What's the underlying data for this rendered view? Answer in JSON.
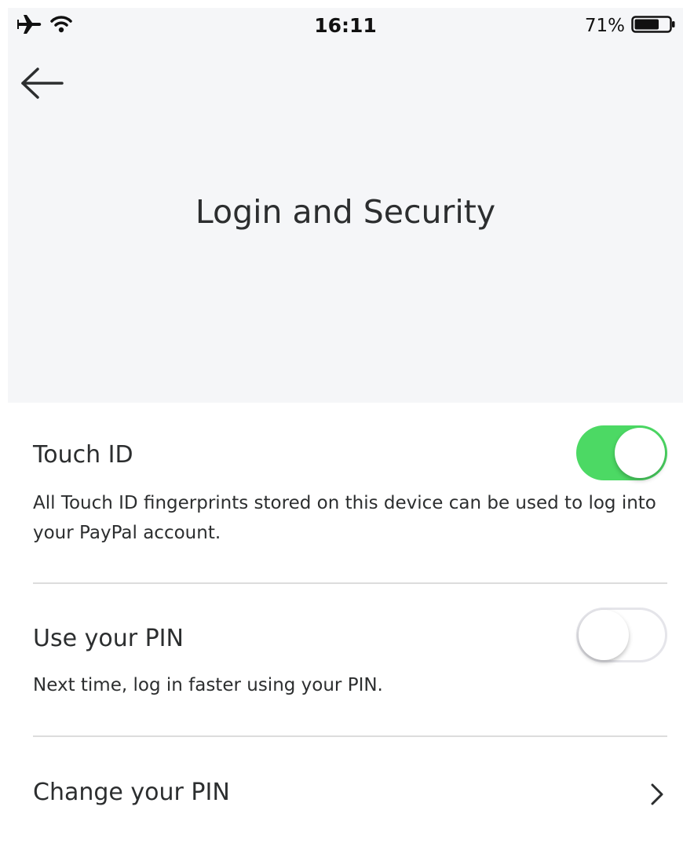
{
  "status_bar": {
    "time": "16:11",
    "battery_percent": "71%",
    "battery_level": 0.71,
    "icons": [
      "airplane-icon",
      "wifi-icon",
      "battery-icon"
    ]
  },
  "header": {
    "title": "Login and Security",
    "back_icon": "arrow-left-icon"
  },
  "settings": {
    "touch_id": {
      "label": "Touch ID",
      "description": "All Touch ID fingerprints stored on this device can be used to log into your PayPal account.",
      "enabled": true
    },
    "use_pin": {
      "label": "Use your PIN",
      "description": "Next time, log in faster using your PIN.",
      "enabled": false
    },
    "change_pin": {
      "label": "Change your PIN",
      "icon": "chevron-right-icon"
    }
  },
  "colors": {
    "header_bg": "#f5f6f8",
    "toggle_on": "#4cd964",
    "toggle_off_border": "#e5e5ea",
    "divider": "#dcdcdc",
    "text": "#2c2e2f"
  }
}
